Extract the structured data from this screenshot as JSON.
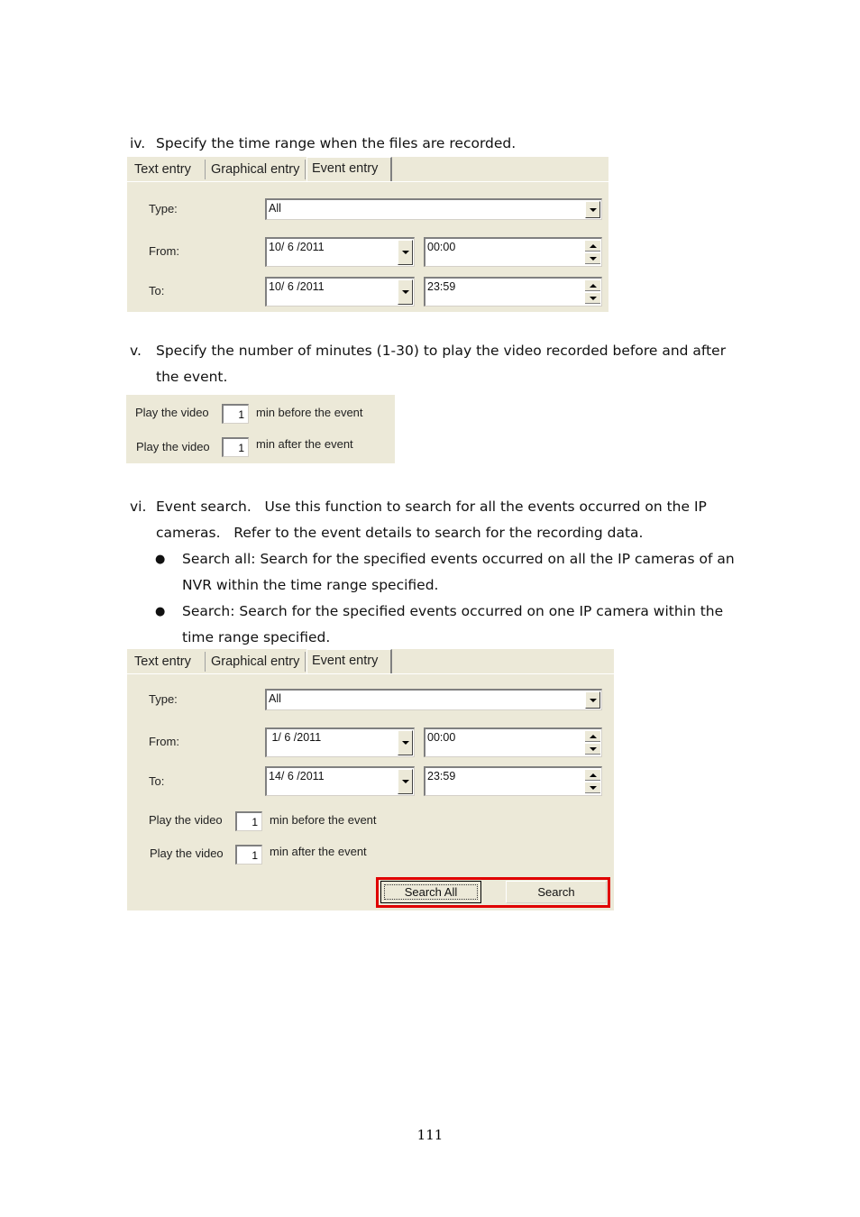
{
  "steps": {
    "iv": {
      "number": "iv.",
      "text": "Specify the time range when the files are recorded."
    },
    "v": {
      "number": "v.",
      "line1": "Specify the number of minutes (1-30) to play the video recorded before and after",
      "line2": "the event."
    },
    "vi": {
      "number": "vi.",
      "line1": "Event search.   Use this function to search for all the events occurred on the IP",
      "line2": "cameras.   Refer to the event details to search for the recording data.",
      "bullets": [
        {
          "line1": "Search all: Search for the specified events occurred on all the IP cameras of an",
          "line2": "NVR within the time range specified."
        },
        {
          "line1": "Search: Search for the specified events occurred on one IP camera within the",
          "line2": "time range specified."
        }
      ],
      "bullet_glyph": "●"
    }
  },
  "tabs": [
    "Text entry",
    "Graphical entry",
    "Event entry"
  ],
  "labels": {
    "type": "Type:",
    "from": "From:",
    "to": "To:",
    "play": "Play the video",
    "before": "min before the event",
    "after": "min after the event"
  },
  "dialog1": {
    "type_value": "All",
    "from_date": "10/ 6 /2011",
    "from_time": "00:00",
    "to_date": "10/ 6 /2011",
    "to_time": "23:59"
  },
  "minutes_panel": {
    "before_value": "1",
    "after_value": "1"
  },
  "dialog2": {
    "type_value": "All",
    "from_date": " 1/ 6 /2011",
    "from_time": "00:00",
    "to_date": "14/ 6 /2011",
    "to_time": "23:59",
    "before_value": "1",
    "after_value": "1",
    "search_all_label": "Search All",
    "search_label": "Search",
    "highlight_color": "#e00000"
  },
  "page_number": "111"
}
